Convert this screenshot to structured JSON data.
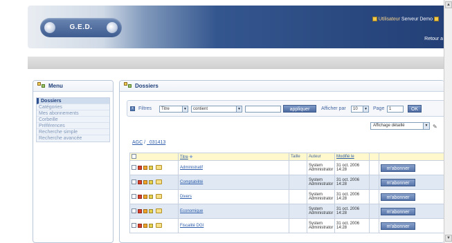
{
  "header": {
    "logo_text": "G.E.D.",
    "user_label": "Utilisateur",
    "server_label": "Serveur Demo",
    "return_link": "Retour a"
  },
  "menu": {
    "title": "Menu",
    "items": [
      {
        "label": "Dossiers"
      },
      {
        "label": "Catégories"
      },
      {
        "label": "Mes abonnements"
      },
      {
        "label": "Corbeille"
      },
      {
        "label": "Préférences"
      },
      {
        "label": "Recherche simple"
      },
      {
        "label": "Recherche avancée"
      }
    ]
  },
  "main": {
    "title": "Dossiers",
    "filter": {
      "label": "Filtres",
      "field_select": "Titre",
      "operator_select": "contient",
      "value": "",
      "apply_button": "appliquer",
      "per_page_label": "Afficher par",
      "per_page_value": "10",
      "page_label": "Page",
      "page_value": "1",
      "ok_button": "OK"
    },
    "display_mode": "Affichage détaillé",
    "breadcrumb": {
      "root": "AGC",
      "separator": " / ",
      "current": "_031413"
    },
    "columns": {
      "title": "Titre",
      "size": "Taille",
      "author": "Auteur",
      "modified": "Modifié le"
    },
    "rows": [
      {
        "title": "Administratif",
        "size": "",
        "author": "System Administrator",
        "modified": "31 oct. 2006 14:28",
        "action": "m'abonner"
      },
      {
        "title": "Comptabilité",
        "size": "",
        "author": "System Administrator",
        "modified": "31 oct. 2006 14:28",
        "action": "m'abonner"
      },
      {
        "title": "Divers",
        "size": "",
        "author": "System Administrator",
        "modified": "31 oct. 2006 14:28",
        "action": "m'abonner"
      },
      {
        "title": "Economique",
        "size": "",
        "author": "System Administrator",
        "modified": "31 oct. 2006 14:28",
        "action": "m'abonner"
      },
      {
        "title": "Fiscalité DGI",
        "size": "",
        "author": "System Administrator",
        "modified": "31 oct. 2006 14:28",
        "action": "m'abonner"
      }
    ]
  }
}
